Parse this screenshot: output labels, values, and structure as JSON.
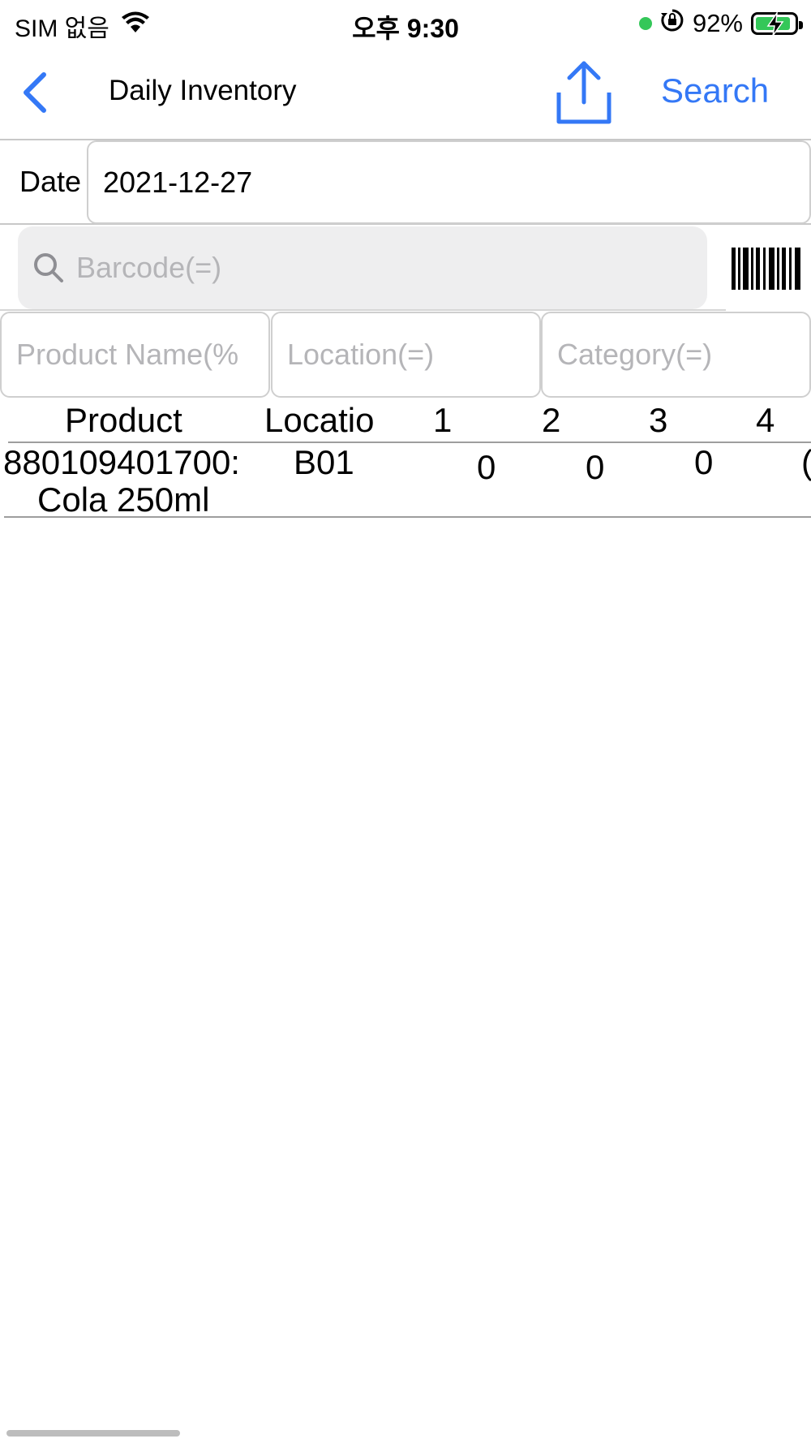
{
  "status_bar": {
    "carrier": "SIM 없음",
    "time": "오후 9:30",
    "battery": "92%",
    "battery_level": 0.92,
    "icons": [
      "wifi-icon",
      "green-dot",
      "orientation-lock-icon",
      "battery-charging-icon"
    ]
  },
  "nav": {
    "back_icon": "chevron-left-icon",
    "title": "Daily Inventory",
    "share_icon": "share-upload-icon",
    "search_label": "Search"
  },
  "date": {
    "label": "Date",
    "value": "2021-12-27"
  },
  "barcode": {
    "placeholder": "Barcode(=)",
    "search_icon": "magnifier-icon",
    "scan_icon": "barcode-icon"
  },
  "filters": {
    "product_name_placeholder": "Product Name(%",
    "location_placeholder": "Location(=)",
    "category_placeholder": "Category(=)"
  },
  "table": {
    "headers": [
      "Product",
      "Locatio",
      "1",
      "2",
      "3",
      "4"
    ],
    "rows": [
      {
        "product_code": "880109401700:",
        "product_name": "Cola 250ml",
        "location": "B01",
        "values": [
          "0",
          "0",
          "0",
          "("
        ]
      }
    ]
  },
  "colors": {
    "accent": "#3478f6",
    "placeholder": "#b5b5b8",
    "search_bg": "#eeeeef",
    "battery_green": "#34c759"
  }
}
